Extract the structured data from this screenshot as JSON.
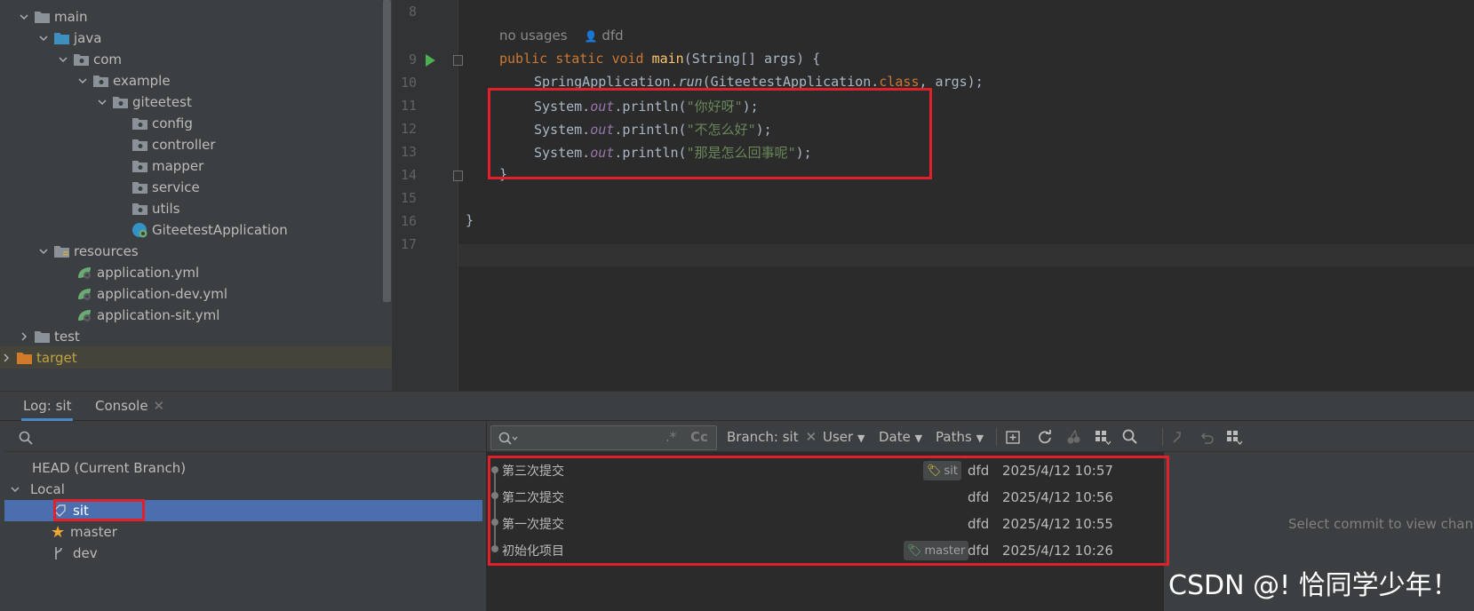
{
  "tree": {
    "items": [
      {
        "label": "main",
        "icon": "folder-icon"
      },
      {
        "label": "java",
        "icon": "source-folder-icon"
      },
      {
        "label": "com",
        "icon": "package-icon"
      },
      {
        "label": "example",
        "icon": "package-icon"
      },
      {
        "label": "giteetest",
        "icon": "package-icon"
      },
      {
        "label": "config",
        "icon": "package-icon"
      },
      {
        "label": "controller",
        "icon": "package-icon"
      },
      {
        "label": "mapper",
        "icon": "package-icon"
      },
      {
        "label": "service",
        "icon": "package-icon"
      },
      {
        "label": "utils",
        "icon": "package-icon"
      },
      {
        "label": "GiteetestApplication",
        "icon": "spring-class-icon"
      },
      {
        "label": "resources",
        "icon": "resources-folder-icon"
      },
      {
        "label": "application.yml",
        "icon": "spring-yml-icon"
      },
      {
        "label": "application-dev.yml",
        "icon": "spring-yml-icon"
      },
      {
        "label": "application-sit.yml",
        "icon": "spring-yml-icon"
      },
      {
        "label": "test",
        "icon": "folder-icon"
      },
      {
        "label": "target",
        "icon": "excluded-folder-icon"
      }
    ]
  },
  "editor": {
    "line_numbers": [
      "8",
      "9",
      "10",
      "11",
      "12",
      "13",
      "14",
      "15",
      "16",
      "17"
    ],
    "hint_usages": "no usages",
    "hint_author": "dfd",
    "line9": {
      "kw1": "public",
      "kw2": "static",
      "kw3": "void",
      "fn": "main",
      "rest": "(String[] args) {"
    },
    "line10": {
      "a": "SpringApplication.",
      "run": "run",
      "b": "(GiteetestApplication.",
      "cls": "class",
      "c": ", args);"
    },
    "println_lines": [
      {
        "a": "System.",
        "out": "out",
        "b": ".println(",
        "str": "\"你好呀\"",
        "c": ");"
      },
      {
        "a": "System.",
        "out": "out",
        "b": ".println(",
        "str": "\"不怎么好\"",
        "c": ");"
      },
      {
        "a": "System.",
        "out": "out",
        "b": ".println(",
        "str": "\"那是怎么回事呢\"",
        "c": ");"
      }
    ],
    "line14": "}",
    "line16": "}"
  },
  "bottom": {
    "tabs": [
      {
        "label": "Log: sit",
        "active": true
      },
      {
        "label": "Console",
        "closable": true
      }
    ],
    "branches": {
      "head": "HEAD (Current Branch)",
      "local": "Local",
      "items": [
        {
          "label": "sit",
          "icon": "tag-icon",
          "selected": true
        },
        {
          "label": "master",
          "icon": "star-icon"
        },
        {
          "label": "dev",
          "icon": "branch-icon"
        }
      ]
    },
    "toolbar": {
      "regex": ".*",
      "case": "Cc",
      "branch_filter": "Branch: sit",
      "user": "User",
      "date": "Date",
      "paths": "Paths"
    },
    "commits": [
      {
        "message": "第三次提交",
        "ref": "sit",
        "author": "dfd",
        "date": "2025/4/12 10:57"
      },
      {
        "message": "第二次提交",
        "ref": "",
        "author": "dfd",
        "date": "2025/4/12 10:56"
      },
      {
        "message": "第一次提交",
        "ref": "",
        "author": "dfd",
        "date": "2025/4/12 10:55"
      },
      {
        "message": "初始化项目",
        "ref": "master",
        "author": "dfd",
        "date": "2025/4/12 10:26"
      }
    ],
    "details_hint": "Select commit to view changes"
  },
  "watermark": "CSDN @! 恰同学少年！",
  "colors": {
    "accent": "#4b6eaf",
    "highlight_box": "#e0202a",
    "keyword": "#cc7832",
    "string": "#6a8759"
  }
}
